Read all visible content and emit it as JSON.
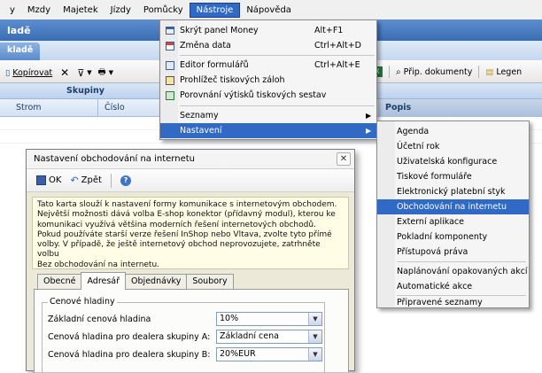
{
  "menubar": {
    "items": [
      "y",
      "Mzdy",
      "Majetek",
      "Jízdy",
      "Pomůcky",
      "Nástroje",
      "Nápověda"
    ],
    "active_index": 5
  },
  "app": {
    "title": "ladě",
    "tab": "kladě"
  },
  "toolbar": {
    "copy_label": "Kopírovat",
    "attach_label": "Přip. dokumenty",
    "legend_label": "Legen"
  },
  "grid": {
    "group_header": "Skupiny",
    "columns": [
      "Strom",
      "Číslo"
    ],
    "popis_header": "Popis"
  },
  "tools_menu": {
    "items": [
      {
        "label": "Skrýt panel Money",
        "shortcut": "Alt+F1",
        "icon": "window-icon"
      },
      {
        "label": "Změna data",
        "shortcut": "Ctrl+Alt+D",
        "icon": "calendar-icon"
      },
      {
        "label": "Editor formulářů",
        "shortcut": "Ctrl+Alt+E",
        "icon": "form-editor-icon"
      },
      {
        "label": "Prohlížeč tiskových záloh",
        "shortcut": "",
        "icon": "print-preview-icon"
      },
      {
        "label": "Porovnání výtisků tiskových sestav",
        "shortcut": "",
        "icon": "compare-icon"
      },
      {
        "label": "Seznamy",
        "shortcut": "",
        "icon": ""
      },
      {
        "label": "Nastavení",
        "shortcut": "",
        "icon": ""
      }
    ]
  },
  "settings_submenu": {
    "items": [
      "Agenda",
      "Účetní rok",
      "Uživatelská konfigurace",
      "Tiskové formuláře",
      "Elektronický platební styk",
      "Obchodování na internetu",
      "Externí aplikace",
      "Pokladní komponenty",
      "Přístupová práva",
      "Naplánování opakovaných akcí",
      "Automatické akce",
      "Připravené seznamy"
    ],
    "highlighted_index": 5
  },
  "dialog": {
    "title": "Nastavení obchodování na internetu",
    "ok_label": "OK",
    "back_label": "Zpět",
    "info_lines": [
      "Tato karta slouží k nastavení formy komunikace s internetovým obchodem.",
      "Největší možnosti dává volba E-shop konektor (přídavný modul), kterou ke",
      "komunikaci využívá většina moderních řešení internetových obchodů.",
      "Pokud používáte starší verze řešení InShop nebo Vltava, zvolte tyto přímé",
      "volby. V případě, že ještě internetový obchod neprovozujete, zatrhněte volbu",
      "Bez obchodování na internetu."
    ],
    "tabs": [
      "Obecné",
      "Adresář",
      "Objednávky",
      "Soubory"
    ],
    "active_tab_index": 1,
    "group_title": "Cenové hladiny",
    "fields": [
      {
        "label": "Základní cenová hladina",
        "value": "10%"
      },
      {
        "label": "Cenová hladina pro dealera skupiny A:",
        "value": "Základní cena"
      },
      {
        "label": "Cenová hladina pro dealera skupiny B:",
        "value": "20%EUR"
      }
    ]
  }
}
